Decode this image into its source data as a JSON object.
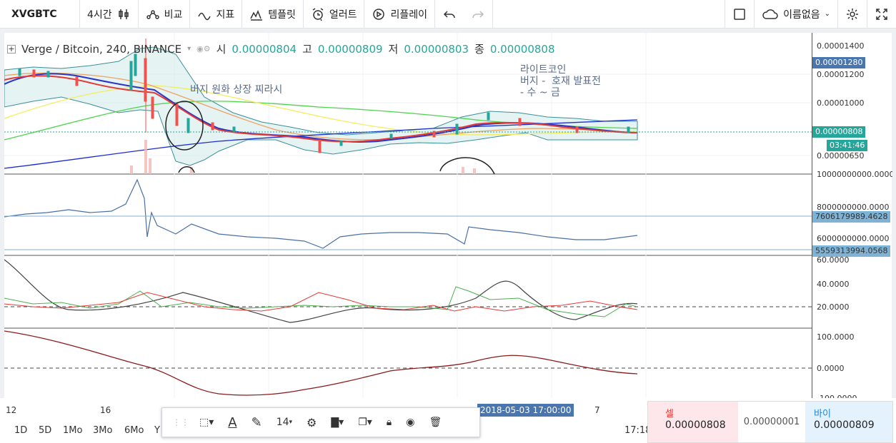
{
  "toolbar": {
    "symbol": "XVGBTC",
    "interval": "4시간",
    "compare": "비교",
    "indicators": "지표",
    "templates": "템플릿",
    "alert": "얼러트",
    "replay": "리플레이",
    "layout_name": "이름없음"
  },
  "legend": {
    "title": "Verge / Bitcoin, 240, BINANCE",
    "open_label": "시",
    "open": "0.00000804",
    "high_label": "고",
    "high": "0.00000809",
    "low_label": "저",
    "low": "0.00000803",
    "close_label": "종",
    "close": "0.00000808"
  },
  "annotations": {
    "note1": "버지 원화 상장 찌라시",
    "note2": "라이트코인\n버지 -  호재 발표전\n- 수 ~ 금"
  },
  "price_scale": {
    "main_ticks": [
      "0.00001400",
      "0.00001200",
      "0.00001000",
      "0.00000650"
    ],
    "current_price_tag": "0.00001280",
    "last_price_tag": "0.00000808",
    "countdown": "03:41:46",
    "pane2_ticks": [
      "10000000000.0000",
      "8000000000.0000",
      "6000000000.0000"
    ],
    "pane2_tag1": "7606179989.4628",
    "pane2_tag2": "5559313994.0568",
    "pane3_ticks": [
      "60.0000",
      "40.0000",
      "20.0000"
    ],
    "pane4_ticks": [
      "100.0000",
      "0.0000",
      "-100.0000"
    ]
  },
  "xaxis": {
    "labels": [
      "12",
      "16",
      "7"
    ],
    "crosshair_time": "2018-05-03 17:00:00"
  },
  "ranges": [
    "1D",
    "5D",
    "1Mo",
    "3Mo",
    "6Mo",
    "Y"
  ],
  "drawing_toolbar": {
    "font_size": "14"
  },
  "trade": {
    "sell_label": "셀",
    "sell_price": "0.00000808",
    "spread": "0.00000001",
    "buy_label": "바이",
    "buy_price": "0.00000809"
  },
  "status": {
    "clock": "17:18"
  },
  "colors": {
    "up": "#26a69a",
    "down": "#ef5350",
    "accent": "#4a76b0",
    "ma_red": "#e53935",
    "ma_blue": "#1e40c8"
  }
}
